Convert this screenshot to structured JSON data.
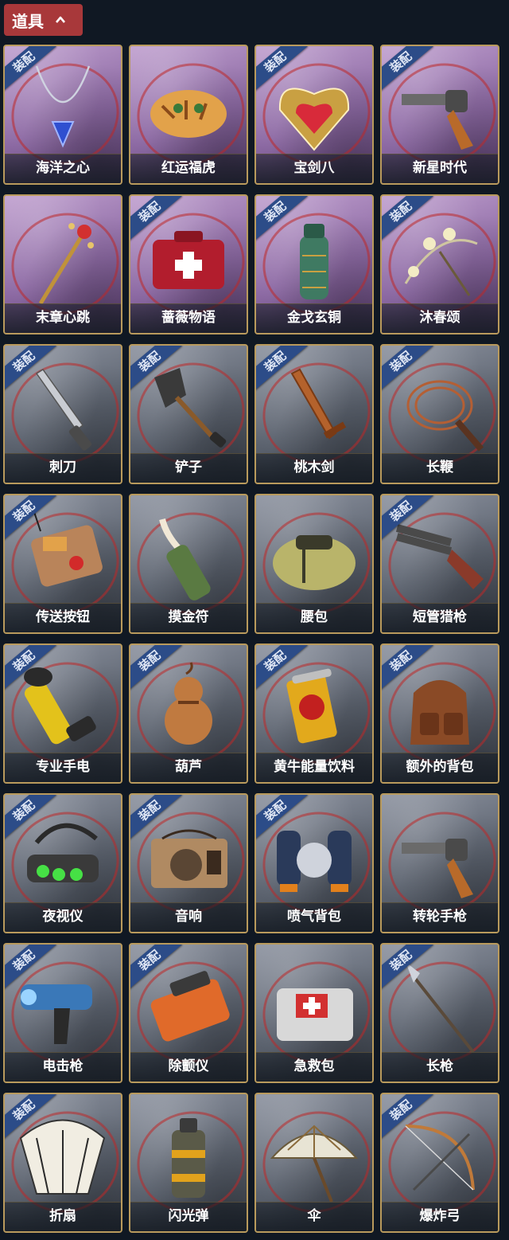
{
  "header": {
    "title": "道具"
  },
  "badge_label": "装配",
  "colors": {
    "header_bg": "#a8383a",
    "page_bg": "#101823",
    "card_border": "#b99a5c",
    "badge_bg": "#2c4c88"
  },
  "items": [
    {
      "name": "海洋之心",
      "equipped": true,
      "rarity": "purple",
      "icon": "necklace-icon"
    },
    {
      "name": "红运福虎",
      "equipped": false,
      "rarity": "purple",
      "icon": "tiger-pillow-icon"
    },
    {
      "name": "宝剑八",
      "equipped": true,
      "rarity": "purple",
      "icon": "heart-medal-icon"
    },
    {
      "name": "新星时代",
      "equipped": true,
      "rarity": "purple",
      "icon": "revolver-icon"
    },
    {
      "name": "末章心跳",
      "equipped": false,
      "rarity": "purple",
      "icon": "scepter-icon"
    },
    {
      "name": "蔷薇物语",
      "equipped": true,
      "rarity": "purple",
      "icon": "medkit-icon"
    },
    {
      "name": "金戈玄铜",
      "equipped": true,
      "rarity": "purple",
      "icon": "bronze-grenade-icon"
    },
    {
      "name": "沐春颂",
      "equipped": true,
      "rarity": "purple",
      "icon": "flower-umbrella-icon"
    },
    {
      "name": "刺刀",
      "equipped": true,
      "rarity": "grey",
      "icon": "bayonet-icon"
    },
    {
      "name": "铲子",
      "equipped": true,
      "rarity": "grey",
      "icon": "shovel-icon"
    },
    {
      "name": "桃木剑",
      "equipped": true,
      "rarity": "grey",
      "icon": "wooden-sword-icon"
    },
    {
      "name": "长鞭",
      "equipped": true,
      "rarity": "grey",
      "icon": "whip-icon"
    },
    {
      "name": "传送按钮",
      "equipped": true,
      "rarity": "grey",
      "icon": "teleport-button-icon"
    },
    {
      "name": "摸金符",
      "equipped": false,
      "rarity": "grey",
      "icon": "talisman-icon"
    },
    {
      "name": "腰包",
      "equipped": false,
      "rarity": "grey",
      "icon": "waist-bag-icon"
    },
    {
      "name": "短管猎枪",
      "equipped": true,
      "rarity": "grey",
      "icon": "shotgun-icon"
    },
    {
      "name": "专业手电",
      "equipped": true,
      "rarity": "grey",
      "icon": "flashlight-icon"
    },
    {
      "name": "葫芦",
      "equipped": true,
      "rarity": "grey",
      "icon": "gourd-icon"
    },
    {
      "name": "黄牛能量饮料",
      "equipped": true,
      "rarity": "grey",
      "icon": "energy-drink-icon"
    },
    {
      "name": "额外的背包",
      "equipped": true,
      "rarity": "grey",
      "icon": "backpack-icon"
    },
    {
      "name": "夜视仪",
      "equipped": true,
      "rarity": "grey",
      "icon": "night-vision-icon"
    },
    {
      "name": "音响",
      "equipped": true,
      "rarity": "grey",
      "icon": "radio-icon"
    },
    {
      "name": "喷气背包",
      "equipped": true,
      "rarity": "grey",
      "icon": "jetpack-icon"
    },
    {
      "name": "转轮手枪",
      "equipped": false,
      "rarity": "grey",
      "icon": "revolver-icon"
    },
    {
      "name": "电击枪",
      "equipped": true,
      "rarity": "grey",
      "icon": "shock-gun-icon"
    },
    {
      "name": "除颤仪",
      "equipped": true,
      "rarity": "grey",
      "icon": "defibrillator-icon"
    },
    {
      "name": "急救包",
      "equipped": false,
      "rarity": "grey",
      "icon": "first-aid-kit-icon"
    },
    {
      "name": "长枪",
      "equipped": true,
      "rarity": "grey",
      "icon": "spear-icon"
    },
    {
      "name": "折扇",
      "equipped": true,
      "rarity": "grey",
      "icon": "folding-fan-icon"
    },
    {
      "name": "闪光弹",
      "equipped": false,
      "rarity": "grey",
      "icon": "flashbang-icon"
    },
    {
      "name": "伞",
      "equipped": false,
      "rarity": "grey",
      "icon": "umbrella-icon"
    },
    {
      "name": "爆炸弓",
      "equipped": true,
      "rarity": "grey",
      "icon": "bow-icon"
    }
  ]
}
